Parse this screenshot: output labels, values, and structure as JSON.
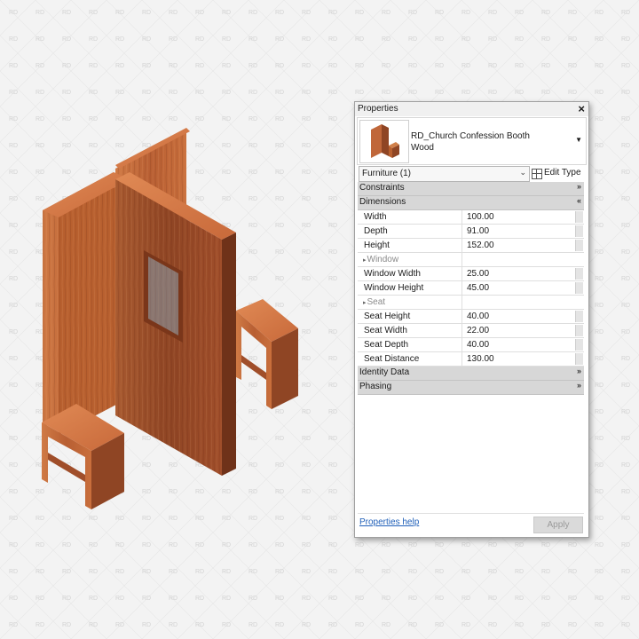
{
  "properties": {
    "title": "Properties",
    "close_label": "×",
    "type_name_line1": "RD_Church Confession Booth",
    "type_name_line2": "Wood",
    "selector_label": "Furniture (1)",
    "edit_type_label": "Edit Type",
    "groups": {
      "constraints": "Constraints",
      "dimensions": "Dimensions",
      "identity": "Identity Data",
      "phasing": "Phasing"
    },
    "rows": [
      {
        "name": "Width",
        "value": "100.00",
        "sub": false
      },
      {
        "name": "Depth",
        "value": "91.00",
        "sub": false
      },
      {
        "name": "Height",
        "value": "152.00",
        "sub": false
      },
      {
        "name": "Window",
        "value": "",
        "sub": true
      },
      {
        "name": "Window Width",
        "value": "25.00",
        "sub": false
      },
      {
        "name": "Window Height",
        "value": "45.00",
        "sub": false
      },
      {
        "name": "Seat",
        "value": "",
        "sub": true
      },
      {
        "name": "Seat Height",
        "value": "40.00",
        "sub": false
      },
      {
        "name": "Seat Width",
        "value": "22.00",
        "sub": false
      },
      {
        "name": "Seat Depth",
        "value": "40.00",
        "sub": false
      },
      {
        "name": "Seat Distance",
        "value": "130.00",
        "sub": false
      }
    ],
    "help_label": "Properties help",
    "apply_label": "Apply"
  },
  "watermark": "RD",
  "colors": {
    "wood_light": "#c86a3a",
    "wood_mid": "#a64f2a",
    "wood_dark": "#7e3a1f",
    "background": "#f3f3f3",
    "group_header": "#d7d7d7"
  }
}
